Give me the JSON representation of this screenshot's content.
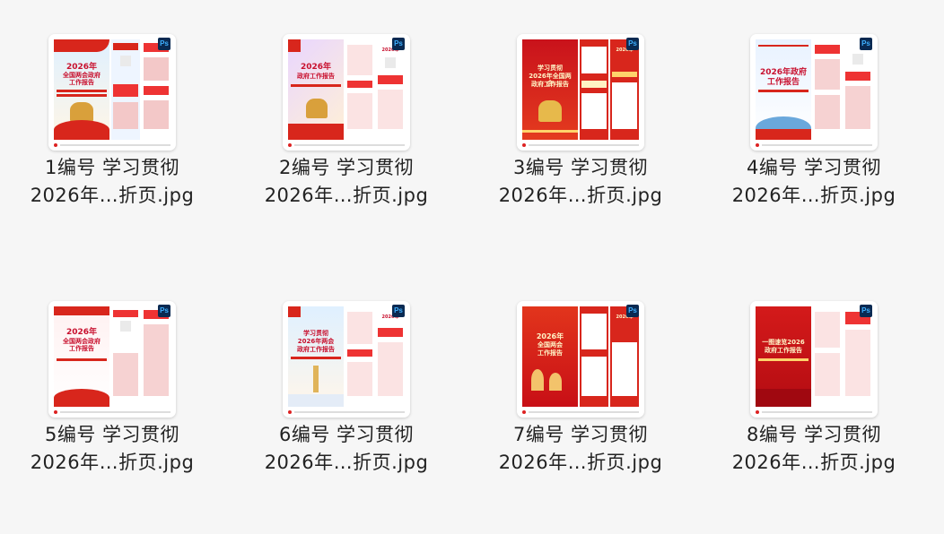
{
  "files": [
    {
      "line1": "1编号 学习贯彻",
      "line2": "2026年…折页.jpg",
      "badge": "Ps",
      "theme": "light",
      "title_lines": [
        "2026年",
        "全国两会政府",
        "工作报告"
      ]
    },
    {
      "line1": "2编号 学习贯彻",
      "line2": "2026年…折页.jpg",
      "badge": "Ps",
      "theme": "light",
      "title_lines": [
        "2026年",
        "政府工作报告"
      ]
    },
    {
      "line1": "3编号 学习贯彻",
      "line2": "2026年…折页.jpg",
      "badge": "Ps",
      "theme": "red",
      "title_lines": [
        "学习贯彻",
        "2026年全国两会",
        "政府工作报告"
      ]
    },
    {
      "line1": "4编号 学习贯彻",
      "line2": "2026年…折页.jpg",
      "badge": "Ps",
      "theme": "light",
      "title_lines": [
        "2026年政府",
        "工作报告"
      ]
    },
    {
      "line1": "5编号 学习贯彻",
      "line2": "2026年…折页.jpg",
      "badge": "Ps",
      "theme": "light",
      "title_lines": [
        "2026年",
        "全国两会政府",
        "工作报告"
      ]
    },
    {
      "line1": "6编号 学习贯彻",
      "line2": "2026年…折页.jpg",
      "badge": "Ps",
      "theme": "light",
      "title_lines": [
        "学习贯彻",
        "2026年两会",
        "政府工作报告"
      ]
    },
    {
      "line1": "7编号 学习贯彻",
      "line2": "2026年…折页.jpg",
      "badge": "Ps",
      "theme": "red",
      "title_lines": [
        "2026年",
        "全国两会",
        "工作报告"
      ]
    },
    {
      "line1": "8编号 学习贯彻",
      "line2": "2026年…折页.jpg",
      "badge": "Ps",
      "theme": "red",
      "title_lines": [
        "一图速览2026",
        "政府工作报告"
      ]
    }
  ],
  "colors": {
    "red": "#d8261c",
    "light_bg": "#eaf3fb",
    "text": "#222222",
    "ps_bg": "#0a2a52",
    "ps_fg": "#3fb0ff"
  }
}
